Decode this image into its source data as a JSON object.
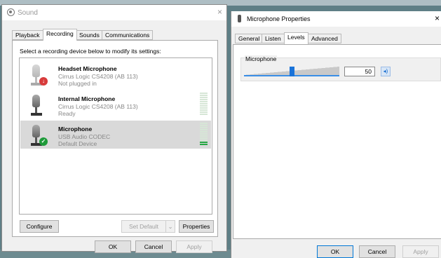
{
  "sound_window": {
    "title": "Sound",
    "close": "×",
    "tabs": [
      {
        "label": "Playback"
      },
      {
        "label": "Recording"
      },
      {
        "label": "Sounds"
      },
      {
        "label": "Communications"
      }
    ],
    "active_tab": "Recording",
    "instruction": "Select a recording device below to modify its settings:",
    "devices": [
      {
        "name": "Headset Microphone",
        "driver": "Cirrus Logic CS4208 (AB 113)",
        "status": "Not plugged in",
        "badge": "red-down-arrow",
        "selected": false
      },
      {
        "name": "Internal Microphone",
        "driver": "Cirrus Logic CS4208 (AB 113)",
        "status": "Ready",
        "badge": "none",
        "selected": false
      },
      {
        "name": "Microphone",
        "driver": "USB Audio CODEC",
        "status": "Default Device",
        "badge": "green-check",
        "selected": true
      }
    ],
    "buttons": {
      "configure": "Configure",
      "set_default": "Set Default",
      "properties": "Properties",
      "ok": "OK",
      "cancel": "Cancel",
      "apply": "Apply"
    }
  },
  "properties_window": {
    "title": "Microphone Properties",
    "close": "×",
    "tabs": [
      {
        "label": "General"
      },
      {
        "label": "Listen"
      },
      {
        "label": "Levels"
      },
      {
        "label": "Advanced"
      }
    ],
    "active_tab": "Levels",
    "levels": {
      "group_label": "Microphone",
      "value": "50",
      "slider_fraction": 0.5,
      "speaker_icon": "speaker-icon"
    },
    "buttons": {
      "ok": "OK",
      "cancel": "Cancel",
      "apply": "Apply"
    }
  },
  "colors": {
    "selection": "#d9d9d9",
    "accent": "#1a73d9",
    "meter_green": "#28a745"
  }
}
